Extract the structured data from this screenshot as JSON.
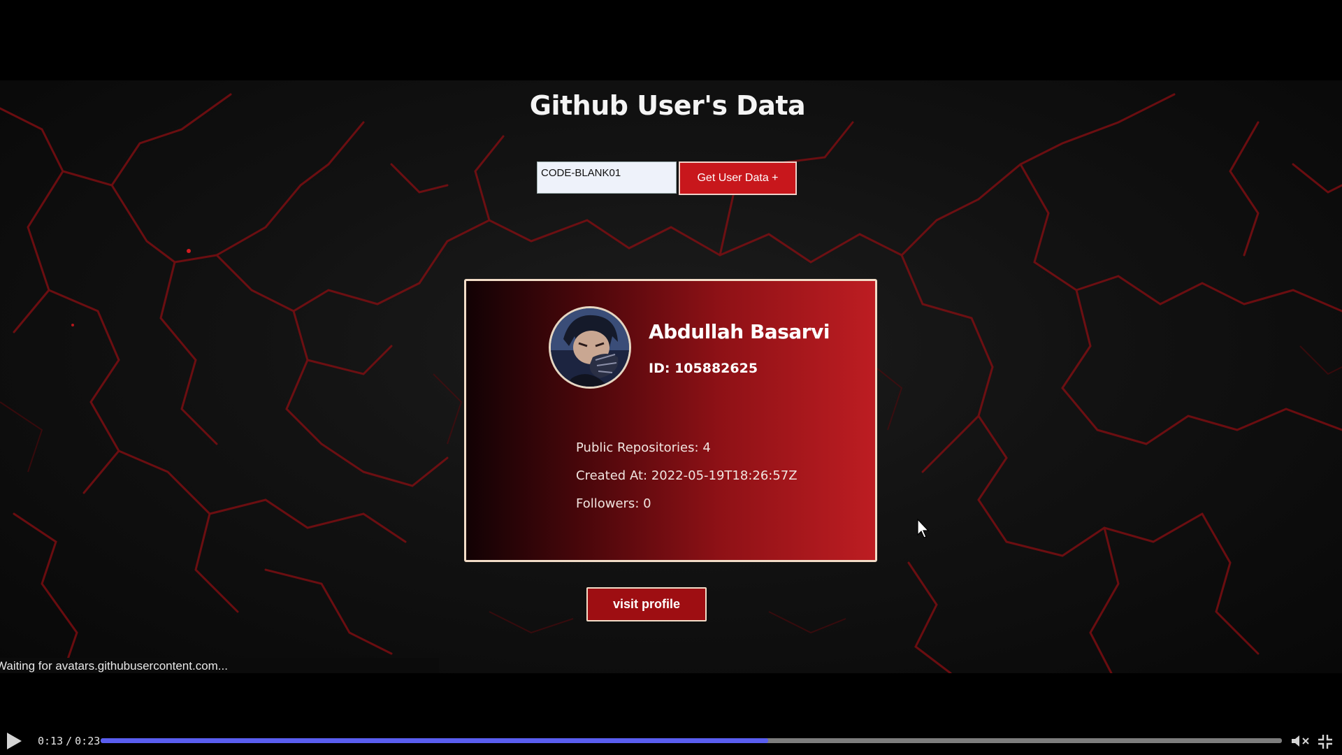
{
  "app": {
    "title": "Github User's Data"
  },
  "search": {
    "value": "CODE-BLANK01",
    "button_label": "Get User Data +"
  },
  "profile": {
    "name": "Abdullah Basarvi",
    "id_label": "ID:",
    "id": "105882625",
    "stats": [
      {
        "label": "Public Repositories:",
        "value": "4"
      },
      {
        "label": "Created At:",
        "value": "2022-05-19T18:26:57Z"
      },
      {
        "label": "Followers:",
        "value": "0"
      }
    ],
    "visit_label": "visit profile"
  },
  "status": {
    "text": "Waiting for avatars.githubusercontent.com..."
  },
  "player": {
    "current_time": "0:13",
    "duration": "0:23",
    "progress": 0.5652,
    "muted": true,
    "accent_color": "#5a5ef0"
  },
  "colors": {
    "accent": "#c8171c",
    "card_border": "#f2dcc7"
  },
  "icons": [
    "play-icon",
    "mute-icon",
    "exit-fullscreen-icon",
    "mouse-cursor-icon",
    "avatar-image"
  ]
}
